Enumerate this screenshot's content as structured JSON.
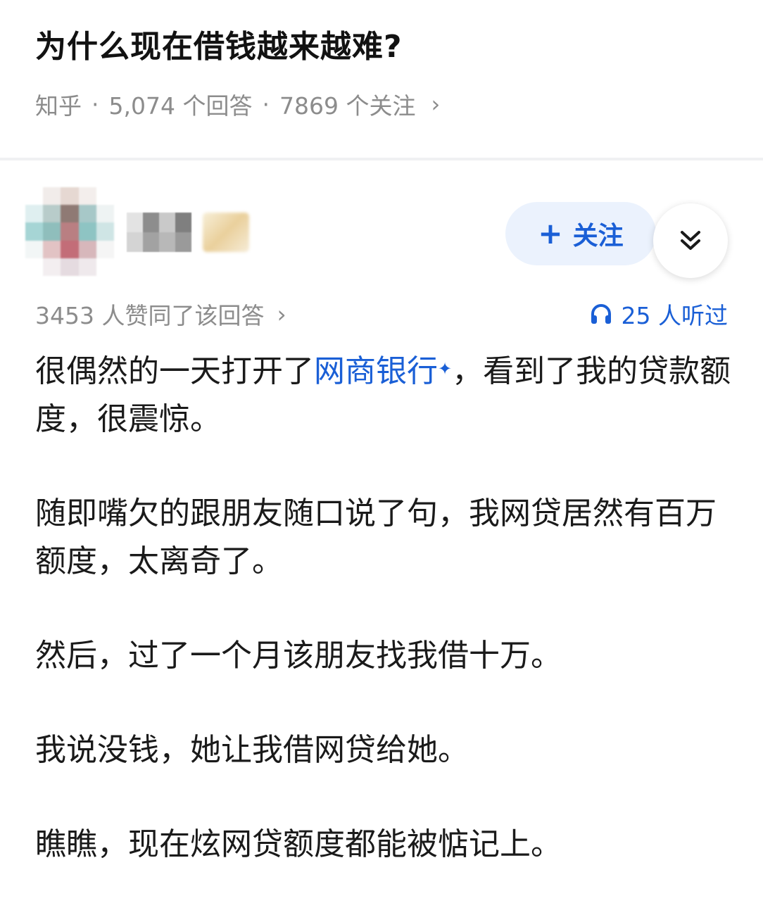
{
  "question": {
    "title": "为什么现在借钱越来越难?",
    "source": "知乎",
    "answers": "5,074 个回答",
    "followers": "7869 个关注",
    "chevron": "›"
  },
  "author": {
    "follow_label": "关注",
    "follow_icon": "plus-icon",
    "expand_icon": "double-chevron-down-icon"
  },
  "stats": {
    "upvotes": "3453 人赞同了该回答",
    "listens": "25 人听过",
    "listen_icon": "headphones-icon"
  },
  "content": {
    "p1_before": "很偶然的一天打开了",
    "p1_link": "网商银行",
    "p1_link_mark": "✦",
    "p1_after": "，看到了我的贷款额度，很震惊。",
    "p2": "随即嘴欠的跟朋友随口说了句，我网贷居然有百万额度，太离奇了。",
    "p3": "然后，过了一个月该朋友找我借十万。",
    "p4": "我说没钱，她让我借网贷给她。",
    "p5": "瞧瞧，现在炫网贷额度都能被惦记上。"
  },
  "colors": {
    "accent": "#1a5fd6",
    "meta_gray": "#8c8c8c",
    "follow_bg": "#ebf2fd"
  }
}
